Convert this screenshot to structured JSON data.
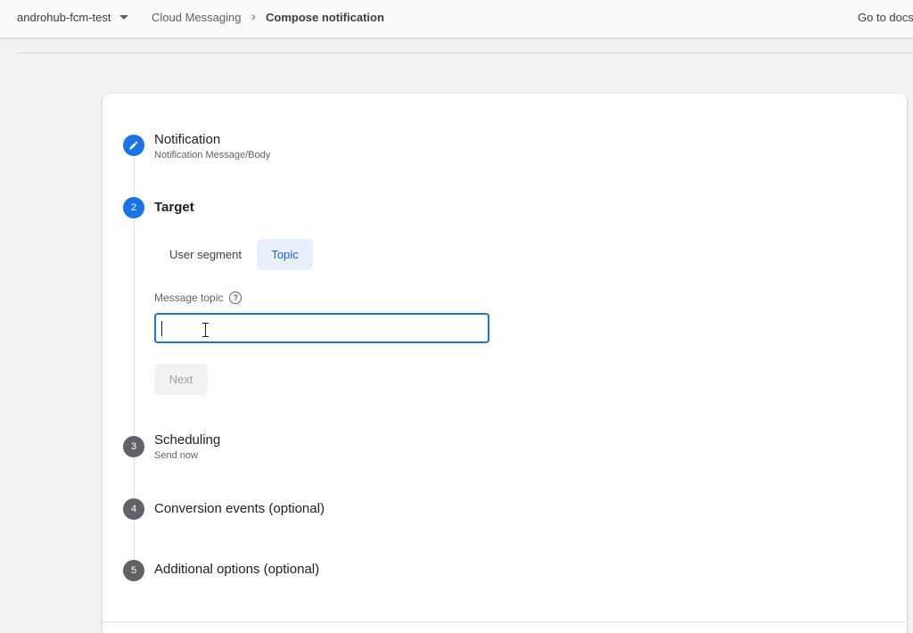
{
  "header": {
    "project": "androhub-fcm-test",
    "breadcrumb_parent": "Cloud Messaging",
    "breadcrumb_separator": "›",
    "breadcrumb_current": "Compose notification",
    "docs_link": "Go to docs"
  },
  "steps": [
    {
      "marker": "✎",
      "title": "Notification",
      "subtitle": "Notification Message/Body",
      "state": "completed"
    },
    {
      "marker": "2",
      "title": "Target",
      "subtitle": "",
      "state": "active"
    },
    {
      "marker": "3",
      "title": "Scheduling",
      "subtitle": "Send now",
      "state": "inactive"
    },
    {
      "marker": "4",
      "title": "Conversion events (optional)",
      "subtitle": "",
      "state": "inactive"
    },
    {
      "marker": "5",
      "title": "Additional options (optional)",
      "subtitle": "",
      "state": "inactive"
    }
  ],
  "target": {
    "tabs": [
      {
        "label": "User segment",
        "selected": false
      },
      {
        "label": "Topic",
        "selected": true
      }
    ],
    "field_label": "Message topic",
    "help_glyph": "?",
    "input_value": "",
    "next_label": "Next"
  },
  "colors": {
    "accent": "#1a73e8",
    "inactive_step": "#5f6368",
    "selected_tab_bg": "#e8f0fe"
  },
  "icons": {
    "project_dropdown": "chevron-down-icon",
    "step1": "pencil-icon",
    "help": "help-circle-icon"
  }
}
